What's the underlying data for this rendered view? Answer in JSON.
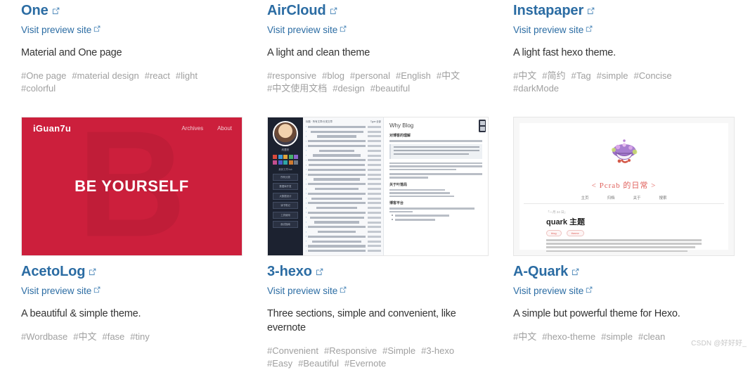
{
  "external_link_icon": "external-link-icon",
  "colors": {
    "link": "#2b6ca3",
    "tag": "#a0a0a0",
    "text": "#333333",
    "aceto_red": "#cc1f3c",
    "quark_accent": "#e0615c"
  },
  "preview_link_label": "Visit preview site",
  "rows": [
    {
      "themes": [
        {
          "title": "One",
          "description": "Material and One page",
          "tags": [
            "#One page",
            "#material design",
            "#react",
            "#light",
            "#colorful"
          ]
        },
        {
          "title": "AirCloud",
          "description": "A light and clean theme",
          "tags": [
            "#responsive",
            "#blog",
            "#personal",
            "#English",
            "#中文",
            "#中文使用文档",
            "#design",
            "#beautiful"
          ]
        },
        {
          "title": "Instapaper",
          "description": "A light fast hexo theme.",
          "tags": [
            "#中文",
            "#简约",
            "#Tag",
            "#simple",
            "#Concise",
            "#darkMode"
          ]
        }
      ]
    },
    {
      "themes": [
        {
          "title": "AcetoLog",
          "description": "A beautiful & simple theme.",
          "tags": [
            "#Wordbase",
            "#中文",
            "#fase",
            "#tiny"
          ]
        },
        {
          "title": "3-hexo",
          "description": "Three sections, simple and convenient, like evernote",
          "tags": [
            "#Convenient",
            "#Responsive",
            "#Simple",
            "#3-hexo",
            "#Easy",
            "#Beautiful",
            "#Evernote"
          ]
        },
        {
          "title": "A-Quark",
          "description": "A simple but powerful theme for Hexo.",
          "tags": [
            "#中文",
            "#hexo-theme",
            "#simple",
            "#clean"
          ]
        }
      ]
    }
  ],
  "thumbnails": {
    "acetolog": {
      "brand": "iGuan7u",
      "nav": [
        "Archives",
        "About"
      ],
      "slogan": "BE YOURSELF",
      "watermark_letter": "B"
    },
    "three_hexo": {
      "sidebar_name": "约瑟夫",
      "sidebar_label": "最新文章/tab",
      "sidebar_menu": [
        "所有分类",
        "数据库开发",
        "大数据设计",
        "读书笔记",
        "工具使用",
        "面试指南"
      ],
      "list_header_left": "标题 · 所有文章/分类文章",
      "list_header_right": "Type:全部",
      "main_title": "Why Blog",
      "main_sections": [
        "对博客的理解",
        "关于叶落局",
        "博客平台"
      ]
    },
    "a_quark": {
      "site_title": "< Pcrab 的日常 >",
      "nav": [
        "主页",
        "归档",
        "关于",
        "搜索"
      ],
      "post_date": "「一月 24 日」",
      "post_title": "quark 主题",
      "post_badges": [
        "blog",
        "theme"
      ]
    }
  },
  "watermark": "CSDN @好好好_"
}
